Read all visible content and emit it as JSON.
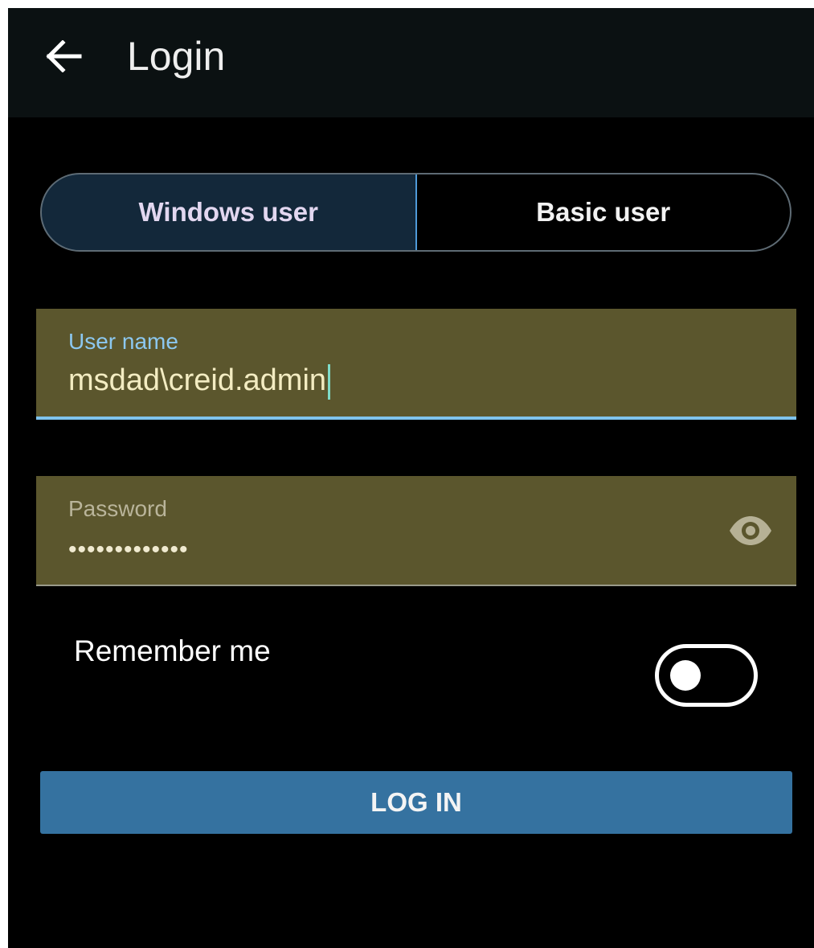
{
  "app_bar": {
    "title": "Login",
    "back_icon": "arrow-left-icon"
  },
  "user_type": {
    "options": [
      "Windows user",
      "Basic user"
    ],
    "selected": "Windows user"
  },
  "username_field": {
    "label": "User name",
    "value": "msdad\\creid.admin"
  },
  "password_field": {
    "label": "Password",
    "masked_value": "•••••••••••••",
    "visibility_icon": "eye-icon"
  },
  "remember_me": {
    "label": "Remember me",
    "enabled": false
  },
  "login_button": {
    "label": "LOG IN"
  },
  "colors": {
    "app_bar_bg": "#0b1112",
    "background": "#000000",
    "field_bg": "#5b562d",
    "focus_accent": "#7fc4ee",
    "selected_segment_bg": "#13283a",
    "button_bg": "#3572a0"
  }
}
